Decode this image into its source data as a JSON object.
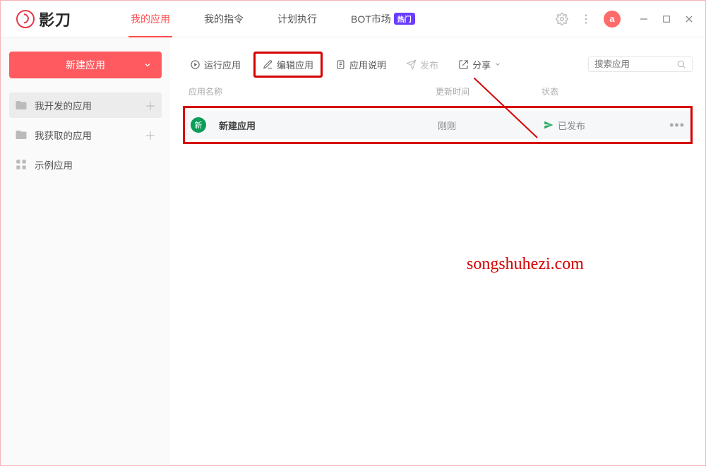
{
  "app": {
    "name": "影刀",
    "avatar_letter": "a"
  },
  "topnav": {
    "items": [
      {
        "label": "我的应用",
        "active": true
      },
      {
        "label": "我的指令",
        "active": false
      },
      {
        "label": "计划执行",
        "active": false
      },
      {
        "label": "BOT市场",
        "active": false,
        "badge": "热门"
      }
    ]
  },
  "sidebar": {
    "new_button": "新建应用",
    "items": [
      {
        "label": "我开发的应用",
        "icon": "folder",
        "add": true,
        "active": true
      },
      {
        "label": "我获取的应用",
        "icon": "folder",
        "add": true,
        "active": false
      },
      {
        "label": "示例应用",
        "icon": "grid",
        "add": false,
        "active": false
      }
    ]
  },
  "toolbar": {
    "run": "运行应用",
    "edit": "编辑应用",
    "desc": "应用说明",
    "publish": "发布",
    "share": "分享",
    "search_placeholder": "搜索应用"
  },
  "columns": {
    "name": "应用名称",
    "time": "更新时间",
    "status": "状态"
  },
  "rows": [
    {
      "badge": "新",
      "name": "新建应用",
      "time": "刚刚",
      "status": "已发布"
    }
  ],
  "watermark": "songshuhezi.com"
}
